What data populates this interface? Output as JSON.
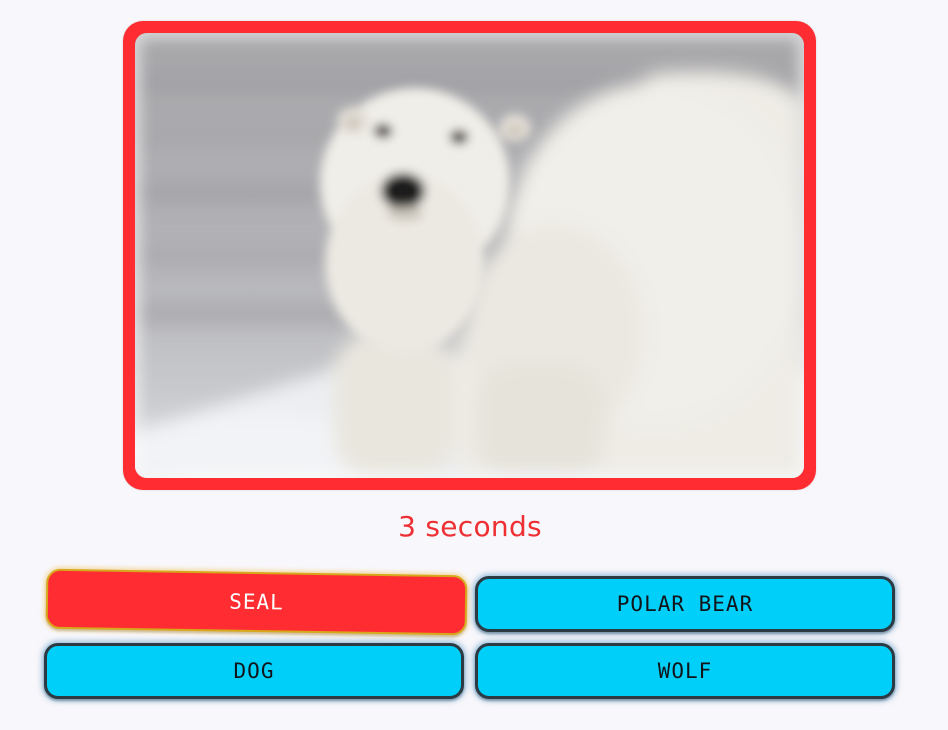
{
  "quiz": {
    "image_subject": "polar-bear-photo",
    "image_state": "blurred",
    "frame_color": "#ff2d31"
  },
  "timer": {
    "text": "3 seconds",
    "color": "#ee2f33"
  },
  "answers": [
    {
      "label": "SEAL",
      "state": "selected-wrong",
      "color": "#ff2d31"
    },
    {
      "label": "POLAR BEAR",
      "state": "default",
      "color": "#00cff9"
    },
    {
      "label": "DOG",
      "state": "default",
      "color": "#00cff9"
    },
    {
      "label": "WOLF",
      "state": "default",
      "color": "#00cff9"
    }
  ]
}
